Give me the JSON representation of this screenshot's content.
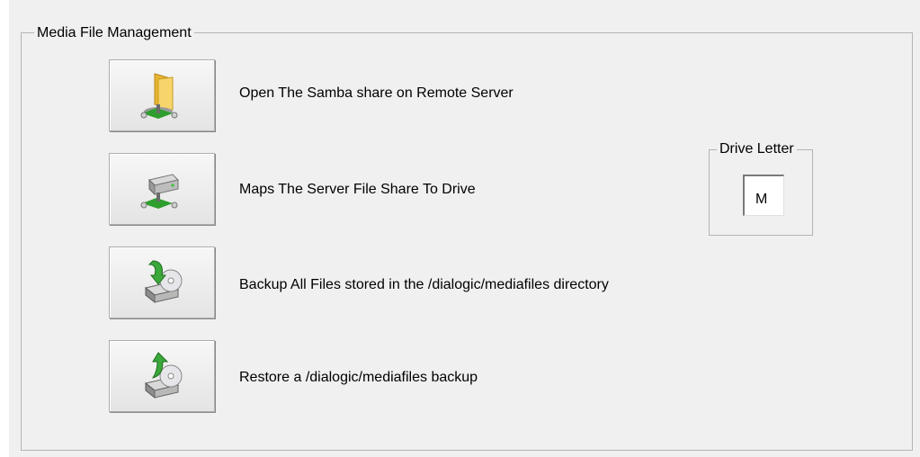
{
  "group": {
    "title": "Media File Management"
  },
  "actions": [
    {
      "icon": "folder-network-icon",
      "label": "Open The Samba share on Remote Server"
    },
    {
      "icon": "network-drive-icon",
      "label": "Maps The Server File Share To Drive"
    },
    {
      "icon": "backup-disk-icon",
      "label": "Backup All Files stored in the /dialogic/mediafiles directory"
    },
    {
      "icon": "restore-disk-icon",
      "label": "Restore a /dialogic/mediafiles backup"
    }
  ],
  "drive": {
    "title": "Drive Letter",
    "value": "M"
  },
  "colors": {
    "panel": "#f0f0f0",
    "border": "#b4b4b4",
    "icon_green": "#2e9e2e",
    "folder_yellow": "#f2c443"
  }
}
